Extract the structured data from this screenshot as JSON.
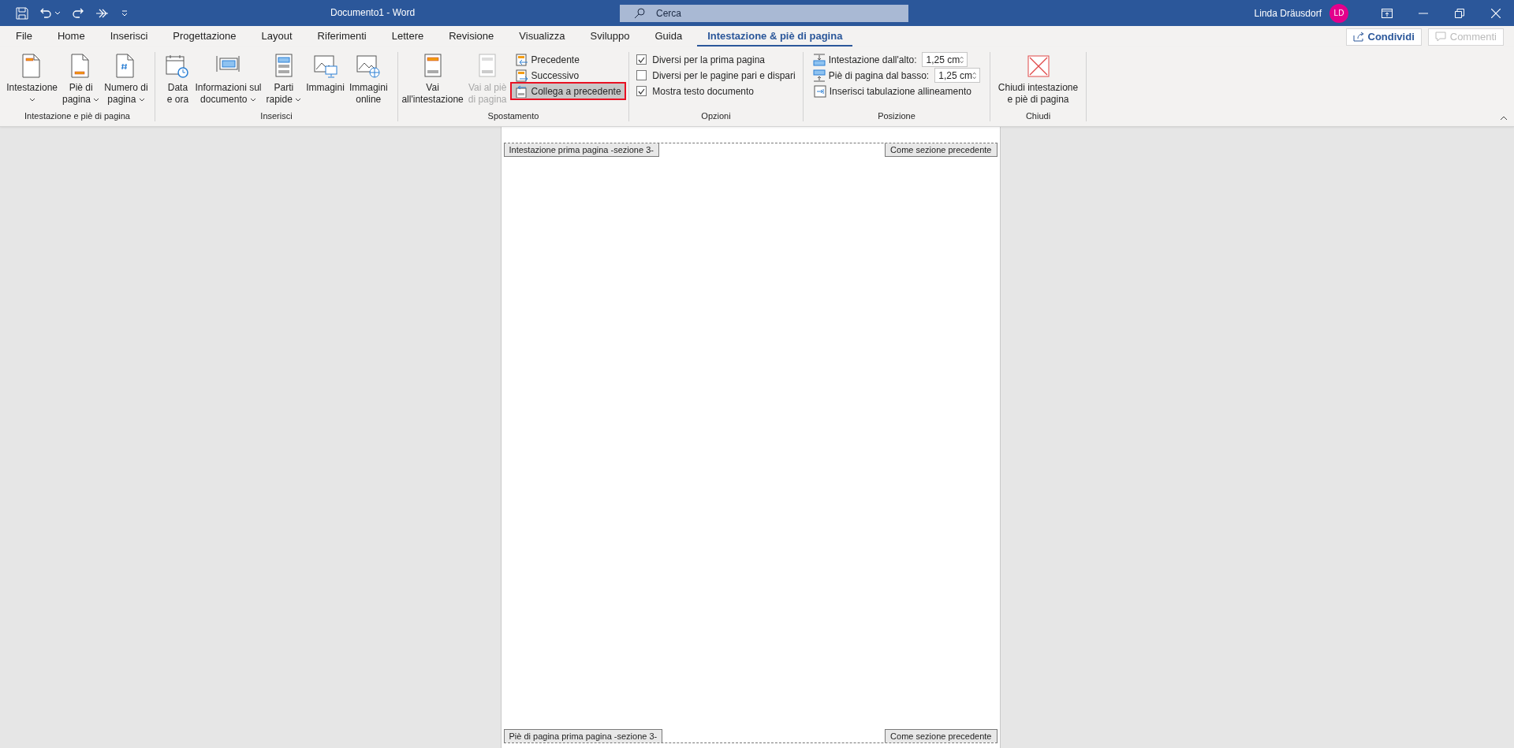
{
  "title_bar": {
    "title": "Documento1  -  Word",
    "search": {
      "placeholder": "Cerca"
    },
    "user": {
      "name": "Linda Dräusdorf",
      "initials": "LD"
    }
  },
  "tabs": [
    {
      "label": "File",
      "selected": false
    },
    {
      "label": "Home",
      "selected": false
    },
    {
      "label": "Inserisci",
      "selected": false
    },
    {
      "label": "Progettazione",
      "selected": false
    },
    {
      "label": "Layout",
      "selected": false
    },
    {
      "label": "Riferimenti",
      "selected": false
    },
    {
      "label": "Lettere",
      "selected": false
    },
    {
      "label": "Revisione",
      "selected": false
    },
    {
      "label": "Visualizza",
      "selected": false
    },
    {
      "label": "Sviluppo",
      "selected": false
    },
    {
      "label": "Guida",
      "selected": false
    },
    {
      "label": "Intestazione & piè di pagina",
      "selected": true
    }
  ],
  "share_button": {
    "label": "Condividi"
  },
  "comments_button": {
    "label": "Commenti",
    "disabled": true
  },
  "ribbon": {
    "groups": [
      {
        "label": "Intestazione e piè di pagina",
        "items": [
          {
            "kind": "large",
            "lines": [
              "Intestazione"
            ],
            "dropdown": true,
            "disabled": false
          },
          {
            "kind": "large",
            "lines": [
              "Piè di",
              "pagina"
            ],
            "dropdown": true,
            "disabled": false
          },
          {
            "kind": "large",
            "lines": [
              "Numero di",
              "pagina"
            ],
            "dropdown": true,
            "disabled": false
          }
        ]
      },
      {
        "label": "Inserisci",
        "items": [
          {
            "kind": "large",
            "lines": [
              "Data",
              "e ora"
            ],
            "dropdown": false,
            "disabled": false
          },
          {
            "kind": "large",
            "lines": [
              "Informazioni sul",
              "documento"
            ],
            "dropdown": true,
            "disabled": false
          },
          {
            "kind": "large",
            "lines": [
              "Parti",
              "rapide"
            ],
            "dropdown": true,
            "disabled": false
          },
          {
            "kind": "large",
            "lines": [
              "Immagini"
            ],
            "dropdown": false,
            "disabled": false
          },
          {
            "kind": "large",
            "lines": [
              "Immagini",
              "online"
            ],
            "dropdown": false,
            "disabled": false
          }
        ]
      },
      {
        "label": "Spostamento",
        "items": [
          {
            "kind": "large",
            "lines": [
              "Vai",
              "all'intestazione"
            ],
            "dropdown": false,
            "disabled": false
          },
          {
            "kind": "large",
            "lines": [
              "Vai al piè",
              "di pagina"
            ],
            "dropdown": false,
            "disabled": true
          },
          {
            "kind": "small",
            "label": "Precedente",
            "selected": false,
            "highlighted": false
          },
          {
            "kind": "small",
            "label": "Successivo",
            "selected": false,
            "highlighted": false
          },
          {
            "kind": "small",
            "label": "Collega a precedente",
            "selected": true,
            "highlighted": true
          }
        ]
      },
      {
        "label": "Opzioni",
        "items": [
          {
            "kind": "checkbox",
            "label": "Diversi per la prima pagina",
            "checked": true
          },
          {
            "kind": "checkbox",
            "label": "Diversi per le pagine pari e dispari",
            "checked": false
          },
          {
            "kind": "checkbox",
            "label": "Mostra testo documento",
            "checked": true
          }
        ]
      },
      {
        "label": "Posizione",
        "items": [
          {
            "kind": "spin",
            "label": "Intestazione dall'alto:",
            "value": "1,25 cm"
          },
          {
            "kind": "spin",
            "label": "Piè di pagina dal basso:",
            "value": "1,25 cm"
          },
          {
            "kind": "small",
            "label": "Inserisci tabulazione allineamento",
            "selected": false,
            "highlighted": false
          }
        ]
      },
      {
        "label": "Chiudi",
        "items": [
          {
            "kind": "large",
            "lines": [
              "Chiudi intestazione",
              "e piè di pagina"
            ],
            "dropdown": false,
            "disabled": false
          }
        ]
      }
    ]
  },
  "document": {
    "header_tag": "Intestazione prima pagina -sezione 3-",
    "header_link_tag": "Come sezione precedente",
    "footer_tag": "Piè di pagina prima pagina -sezione 3-",
    "footer_link_tag": "Come sezione precedente"
  }
}
